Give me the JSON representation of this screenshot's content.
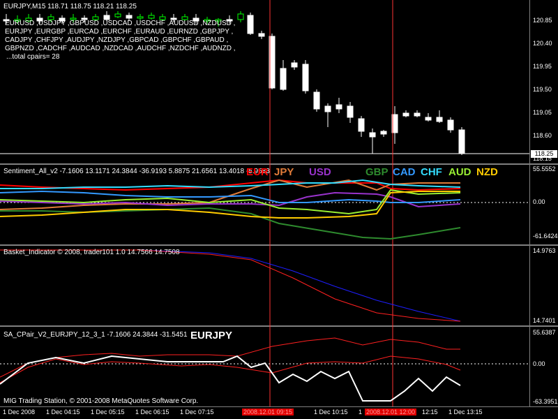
{
  "main": {
    "title": "EURJPY,M15  118.71 118.75 118.21 118.25",
    "pairs_lines": [
      "EURUSD ,USDJPY ,GBPUSD ,USDCAD ,USDCHF ,AUDUSD ,NZDUSD ,",
      "EURJPY ,EURGBP ,EURCAD ,EURCHF ,EURAUD ,EURNZD ,GBPJPY ,",
      "CADJPY ,CHFJPY ,AUDJPY ,NZDJPY ,GBPCAD ,GBPCHF ,GBPAUD ,",
      "GBPNZD ,CADCHF ,AUDCAD ,NZDCAD ,AUDCHF ,NZDCHF ,AUDNZD ,"
    ],
    "total_pairs": "...total cpairs= 28",
    "price_labels": [
      "120.85",
      "120.40",
      "119.95",
      "119.50",
      "119.05",
      "118.60",
      "118.15"
    ],
    "current_price": "118.25"
  },
  "sentiment": {
    "title": "Sentiment_All_v2  -7.1606 13.1171 24.3844 -36.9193 5.8875 21.6561 13.4018 -5.9583",
    "currencies": [
      {
        "code": "EUR",
        "color": "#ff0000"
      },
      {
        "code": "JPY",
        "color": "#e07b39"
      },
      {
        "code": "USD",
        "color": "#9933cc"
      },
      {
        "code": "GBP",
        "color": "#2e8b2e"
      },
      {
        "code": "CAD",
        "color": "#3399ff"
      },
      {
        "code": "CHF",
        "color": "#33ddff"
      },
      {
        "code": "AUD",
        "color": "#99ee33"
      },
      {
        "code": "NZD",
        "color": "#ffcc00"
      }
    ],
    "scale": [
      "55.5552",
      "0.00",
      "-61.6424"
    ]
  },
  "basket": {
    "title": "Basket_Indicator © 2008, trader101 1.0 14.7566 14.7508",
    "scale": [
      "14.9763",
      "14.7401"
    ]
  },
  "cpair": {
    "title": "SA_CPair_V2_EURJPY_12_3_1 -7.1606 24.3844 -31.5451",
    "symbol": "EURJPY",
    "copyright": "MIG Trading Station, © 2001-2008 MetaQuotes Software Corp.",
    "scale": [
      "55.6387",
      "0.00",
      "-63.3951"
    ]
  },
  "time_axis": [
    {
      "text": "1 Dec 2008",
      "hl": false
    },
    {
      "text": "1 Dec 04:15",
      "hl": false
    },
    {
      "text": "1 Dec 05:15",
      "hl": false
    },
    {
      "text": "1 Dec 06:15",
      "hl": false
    },
    {
      "text": "1 Dec 07:15",
      "hl": false
    },
    {
      "text": "2008.12.01 09:15",
      "hl": true
    },
    {
      "text": "1 Dec 10:15",
      "hl": false
    },
    {
      "text": "1",
      "hl": false
    },
    {
      "text": "2008.12.01 12:00",
      "hl": true
    },
    {
      "text": "12:15",
      "hl": false
    },
    {
      "text": "1 Dec 13:15",
      "hl": false
    }
  ],
  "colors": {
    "bull_candle": "#00ff00",
    "bear_candle": "#ffffff",
    "vline": "#ff3333",
    "basket_blue": "#1e1eff",
    "basket_red": "#ff2020"
  }
}
